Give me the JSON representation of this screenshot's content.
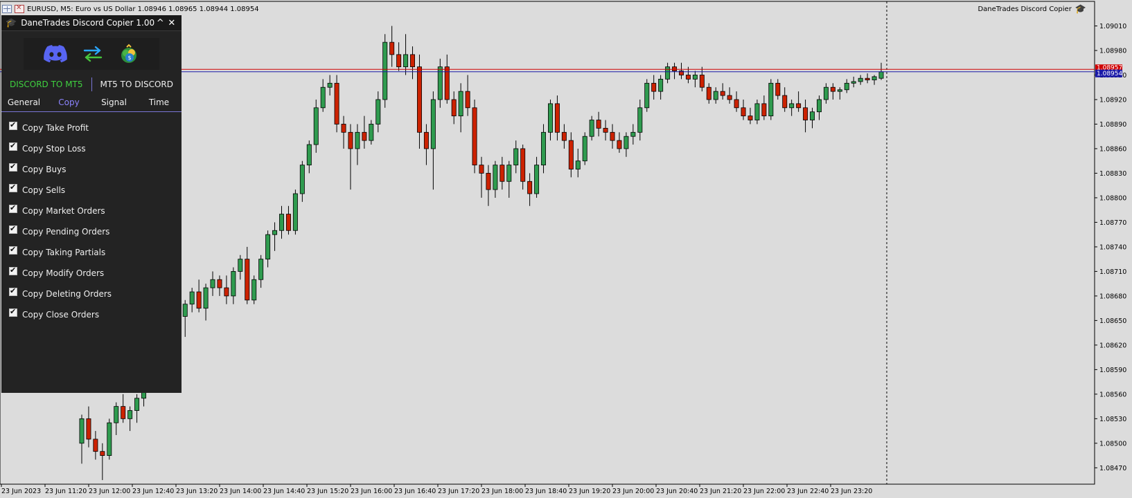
{
  "window": {
    "title_text": "EURUSD, M5:  Euro vs US Dollar  1.08946 1.08965 1.08944 1.08954",
    "ea_label": "DaneTrades Discord Copier"
  },
  "panel": {
    "title": "DaneTrades Discord Copier 1.00",
    "minimize_glyph": "^",
    "close_glyph": "✕",
    "modes": [
      {
        "label": "DISCORD TO MT5",
        "active": true
      },
      {
        "label": "MT5 TO DISCORD",
        "active": false
      }
    ],
    "tabs": [
      {
        "label": "General",
        "active": false
      },
      {
        "label": "Copy",
        "active": true
      },
      {
        "label": "Signal",
        "active": false
      },
      {
        "label": "Time",
        "active": false
      }
    ],
    "options": [
      {
        "label": "Copy Take Profit",
        "checked": true
      },
      {
        "label": "Copy Stop Loss",
        "checked": true
      },
      {
        "label": "Copy Buys",
        "checked": true
      },
      {
        "label": "Copy Sells",
        "checked": true
      },
      {
        "label": "Copy Market Orders",
        "checked": true
      },
      {
        "label": "Copy Pending Orders",
        "checked": true
      },
      {
        "label": "Copy Taking Partials",
        "checked": true
      },
      {
        "label": "Copy Modify Orders",
        "checked": true
      },
      {
        "label": "Copy Deleting Orders",
        "checked": true
      },
      {
        "label": "Copy Close Orders",
        "checked": true
      }
    ],
    "icons": [
      "discord-logo",
      "swap-arrows-icon",
      "metatrader-logo"
    ]
  },
  "colors": {
    "bull": "#2f9b4f",
    "bear": "#cc2200",
    "ask_line": "#d00000",
    "bid_line": "#1a1aa8",
    "mode_active": "#3fd13f",
    "tab_active": "#8c84ff"
  },
  "chart_data": {
    "type": "candlestick",
    "symbol": "EURUSD",
    "timeframe": "M5",
    "ohlc_last": {
      "open": 1.08946,
      "high": 1.08965,
      "low": 1.08944,
      "close": 1.08954
    },
    "ylim": [
      1.0845,
      1.0904
    ],
    "y_ticks": [
      "1.09010",
      "1.08980",
      "1.08950",
      "1.08920",
      "1.08890",
      "1.08860",
      "1.08830",
      "1.08800",
      "1.08770",
      "1.08740",
      "1.08710",
      "1.08680",
      "1.08650",
      "1.08620",
      "1.08590",
      "1.08560",
      "1.08530",
      "1.08500",
      "1.08470"
    ],
    "x_ticks": [
      "23 Jun 2023",
      "23 Jun 11:20",
      "23 Jun 12:00",
      "23 Jun 12:40",
      "23 Jun 13:20",
      "23 Jun 14:00",
      "23 Jun 14:40",
      "23 Jun 15:20",
      "23 Jun 16:00",
      "23 Jun 16:40",
      "23 Jun 17:20",
      "23 Jun 18:00",
      "23 Jun 18:40",
      "23 Jun 19:20",
      "23 Jun 20:00",
      "23 Jun 20:40",
      "23 Jun 21:20",
      "23 Jun 22:00",
      "23 Jun 22:40",
      "23 Jun 23:20"
    ],
    "bid_price": 1.08954,
    "bid_label": "1.08954",
    "ask_label": "1.08957",
    "ask_price": 1.08957,
    "candles": [
      [
        1.085,
        1.08535,
        1.08475,
        1.0853
      ],
      [
        1.0853,
        1.08545,
        1.08495,
        1.08505
      ],
      [
        1.08505,
        1.08515,
        1.0848,
        1.0849
      ],
      [
        1.0849,
        1.085,
        1.08455,
        1.08485
      ],
      [
        1.08485,
        1.0853,
        1.0848,
        1.08525
      ],
      [
        1.08525,
        1.0855,
        1.0851,
        1.08545
      ],
      [
        1.08545,
        1.0856,
        1.08525,
        1.0853
      ],
      [
        1.0853,
        1.08545,
        1.08515,
        1.0854
      ],
      [
        1.0854,
        1.0856,
        1.08525,
        1.08555
      ],
      [
        1.08555,
        1.0859,
        1.08545,
        1.08585
      ],
      [
        1.08585,
        1.0862,
        1.08575,
        1.08615
      ],
      [
        1.08615,
        1.0865,
        1.086,
        1.08645
      ],
      [
        1.08645,
        1.08665,
        1.0863,
        1.0864
      ],
      [
        1.0864,
        1.0867,
        1.0863,
        1.08665
      ],
      [
        1.08665,
        1.0868,
        1.08645,
        1.08655
      ],
      [
        1.08655,
        1.08675,
        1.0863,
        1.0867
      ],
      [
        1.0867,
        1.0869,
        1.0866,
        1.08685
      ],
      [
        1.08685,
        1.087,
        1.0866,
        1.08665
      ],
      [
        1.08665,
        1.08695,
        1.0865,
        1.0869
      ],
      [
        1.0869,
        1.0871,
        1.0868,
        1.087
      ],
      [
        1.087,
        1.08705,
        1.0868,
        1.0869
      ],
      [
        1.0869,
        1.08705,
        1.0867,
        1.0868
      ],
      [
        1.0868,
        1.08715,
        1.0867,
        1.0871
      ],
      [
        1.0871,
        1.0873,
        1.087,
        1.08725
      ],
      [
        1.08725,
        1.0874,
        1.0867,
        1.08675
      ],
      [
        1.08675,
        1.08705,
        1.0867,
        1.087
      ],
      [
        1.087,
        1.0873,
        1.0869,
        1.08725
      ],
      [
        1.08725,
        1.0876,
        1.08715,
        1.08755
      ],
      [
        1.08755,
        1.0877,
        1.08735,
        1.0876
      ],
      [
        1.0876,
        1.0879,
        1.0875,
        1.0878
      ],
      [
        1.0878,
        1.0879,
        1.08755,
        1.0876
      ],
      [
        1.0876,
        1.0881,
        1.08755,
        1.08805
      ],
      [
        1.08805,
        1.08845,
        1.08795,
        1.0884
      ],
      [
        1.0884,
        1.0887,
        1.0883,
        1.08865
      ],
      [
        1.08865,
        1.0892,
        1.08855,
        1.0891
      ],
      [
        1.0891,
        1.08945,
        1.08905,
        1.08935
      ],
      [
        1.08935,
        1.0895,
        1.08925,
        1.0894
      ],
      [
        1.0894,
        1.0895,
        1.0888,
        1.0889
      ],
      [
        1.0889,
        1.089,
        1.0886,
        1.0888
      ],
      [
        1.0888,
        1.0889,
        1.0881,
        1.0886
      ],
      [
        1.0886,
        1.0889,
        1.0884,
        1.0888
      ],
      [
        1.0888,
        1.089,
        1.0886,
        1.0887
      ],
      [
        1.0887,
        1.08895,
        1.08865,
        1.0889
      ],
      [
        1.0889,
        1.0893,
        1.0888,
        1.0892
      ],
      [
        1.0892,
        1.09,
        1.0891,
        1.0899
      ],
      [
        1.0899,
        1.0901,
        1.0896,
        1.08975
      ],
      [
        1.08975,
        1.0899,
        1.08955,
        1.0896
      ],
      [
        1.0896,
        1.09,
        1.0895,
        1.08975
      ],
      [
        1.08975,
        1.08985,
        1.08945,
        1.0896
      ],
      [
        1.0896,
        1.08975,
        1.0886,
        1.0888
      ],
      [
        1.0888,
        1.0889,
        1.0884,
        1.0886
      ],
      [
        1.0886,
        1.0893,
        1.0881,
        1.0892
      ],
      [
        1.0892,
        1.0897,
        1.0891,
        1.0896
      ],
      [
        1.0896,
        1.08975,
        1.08915,
        1.0892
      ],
      [
        1.0892,
        1.0893,
        1.0889,
        1.089
      ],
      [
        1.089,
        1.0894,
        1.0888,
        1.0893
      ],
      [
        1.0893,
        1.0895,
        1.089,
        1.0891
      ],
      [
        1.0891,
        1.0892,
        1.0883,
        1.0884
      ],
      [
        1.0884,
        1.0885,
        1.088,
        1.0883
      ],
      [
        1.0883,
        1.0884,
        1.0879,
        1.0881
      ],
      [
        1.0881,
        1.08845,
        1.088,
        1.0884
      ],
      [
        1.0884,
        1.0885,
        1.0881,
        1.0882
      ],
      [
        1.0882,
        1.08845,
        1.088,
        1.0884
      ],
      [
        1.0884,
        1.0887,
        1.0883,
        1.0886
      ],
      [
        1.0886,
        1.08865,
        1.0881,
        1.0882
      ],
      [
        1.0882,
        1.0883,
        1.0879,
        1.08805
      ],
      [
        1.08805,
        1.0885,
        1.088,
        1.0884
      ],
      [
        1.0884,
        1.0889,
        1.0883,
        1.0888
      ],
      [
        1.0888,
        1.0892,
        1.0887,
        1.08915
      ],
      [
        1.08915,
        1.08925,
        1.0887,
        1.0888
      ],
      [
        1.0888,
        1.0889,
        1.0886,
        1.0887
      ],
      [
        1.0887,
        1.0888,
        1.08825,
        1.08835
      ],
      [
        1.08835,
        1.0886,
        1.08825,
        1.08845
      ],
      [
        1.08845,
        1.0888,
        1.0884,
        1.08875
      ],
      [
        1.08875,
        1.089,
        1.0887,
        1.08895
      ],
      [
        1.08895,
        1.08905,
        1.08875,
        1.08885
      ],
      [
        1.08885,
        1.08895,
        1.0887,
        1.0888
      ],
      [
        1.0888,
        1.0889,
        1.0886,
        1.0887
      ],
      [
        1.0887,
        1.0888,
        1.08855,
        1.0886
      ],
      [
        1.0886,
        1.0888,
        1.0885,
        1.08875
      ],
      [
        1.08875,
        1.0889,
        1.08865,
        1.0888
      ],
      [
        1.0888,
        1.0892,
        1.0887,
        1.0891
      ],
      [
        1.0891,
        1.08945,
        1.08905,
        1.0894
      ],
      [
        1.0894,
        1.0895,
        1.0892,
        1.0893
      ],
      [
        1.0893,
        1.0895,
        1.0892,
        1.08945
      ],
      [
        1.08945,
        1.08965,
        1.0894,
        1.0896
      ],
      [
        1.0896,
        1.08965,
        1.08945,
        1.08955
      ],
      [
        1.08955,
        1.08965,
        1.08945,
        1.0895
      ],
      [
        1.0895,
        1.0896,
        1.0894,
        1.08945
      ],
      [
        1.08945,
        1.08955,
        1.08935,
        1.0895
      ],
      [
        1.0895,
        1.0896,
        1.0893,
        1.08935
      ],
      [
        1.08935,
        1.0894,
        1.08915,
        1.0892
      ],
      [
        1.0892,
        1.08935,
        1.08915,
        1.0893
      ],
      [
        1.0893,
        1.0894,
        1.0892,
        1.08925
      ],
      [
        1.08925,
        1.08935,
        1.08915,
        1.0892
      ],
      [
        1.0892,
        1.0893,
        1.08905,
        1.0891
      ],
      [
        1.0891,
        1.0892,
        1.08895,
        1.089
      ],
      [
        1.089,
        1.0891,
        1.0889,
        1.08895
      ],
      [
        1.08895,
        1.0892,
        1.0889,
        1.08915
      ],
      [
        1.08915,
        1.08925,
        1.08895,
        1.089
      ],
      [
        1.089,
        1.08945,
        1.08895,
        1.0894
      ],
      [
        1.0894,
        1.08945,
        1.0892,
        1.08925
      ],
      [
        1.08925,
        1.08935,
        1.08905,
        1.0891
      ],
      [
        1.0891,
        1.0892,
        1.089,
        1.08915
      ],
      [
        1.08915,
        1.0893,
        1.08905,
        1.0891
      ],
      [
        1.0891,
        1.0892,
        1.0888,
        1.08895
      ],
      [
        1.08895,
        1.0891,
        1.08885,
        1.08905
      ],
      [
        1.08905,
        1.08925,
        1.08895,
        1.0892
      ],
      [
        1.0892,
        1.0894,
        1.08915,
        1.08935
      ],
      [
        1.08935,
        1.0894,
        1.0892,
        1.0893
      ],
      [
        1.0893,
        1.08935,
        1.0892,
        1.08932
      ],
      [
        1.08932,
        1.08945,
        1.08928,
        1.0894
      ],
      [
        1.0894,
        1.08948,
        1.08935,
        1.08942
      ],
      [
        1.08942,
        1.0895,
        1.08938,
        1.08946
      ],
      [
        1.08946,
        1.08952,
        1.0894,
        1.08944
      ],
      [
        1.08944,
        1.0895,
        1.08938,
        1.08948
      ],
      [
        1.08946,
        1.08965,
        1.08944,
        1.08954
      ]
    ]
  }
}
